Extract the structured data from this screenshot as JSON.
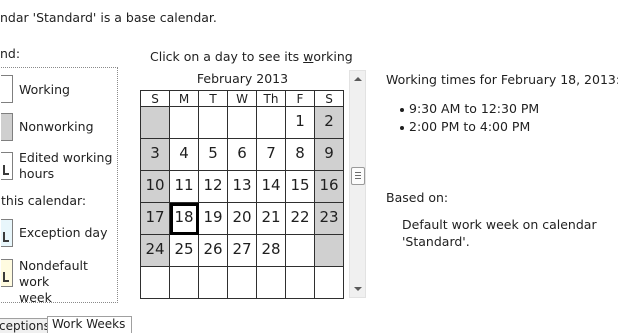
{
  "header": {
    "base_calendar_text": "ndar 'Standard' is a base calendar."
  },
  "legend": {
    "title": "nd:",
    "items": [
      {
        "label": "Working"
      },
      {
        "label": "Nonworking"
      },
      {
        "label_line1": "Edited working",
        "label_line2": "hours"
      }
    ],
    "section_title": "this calendar:",
    "calendar_items": [
      {
        "label": "Exception day"
      },
      {
        "label_line1": "Nondefault work",
        "label_line2": "week"
      }
    ]
  },
  "calendar": {
    "instruction_prefix": "Click on a day to see its ",
    "instruction_key": "w",
    "instruction_suffix": "orking",
    "month_title": "February 2013",
    "weekday_headers": [
      "S",
      "M",
      "T",
      "W",
      "Th",
      "F",
      "S"
    ],
    "weeks": [
      [
        "",
        "",
        "",
        "",
        "",
        "1",
        "2"
      ],
      [
        "3",
        "4",
        "5",
        "6",
        "7",
        "8",
        "9"
      ],
      [
        "10",
        "11",
        "12",
        "13",
        "14",
        "15",
        "16"
      ],
      [
        "17",
        "18",
        "19",
        "20",
        "21",
        "22",
        "23"
      ],
      [
        "24",
        "25",
        "26",
        "27",
        "28",
        "",
        ""
      ],
      [
        "",
        "",
        "",
        "",
        "",
        "",
        ""
      ]
    ],
    "selected_day": "18"
  },
  "working_times": {
    "title": "Working times for February 18, 2013:",
    "times": [
      "9:30 AM to 12:30 PM",
      "2:00 PM to 4:00 PM"
    ]
  },
  "based_on": {
    "title": "Based on:",
    "line1": "Default work week on calendar",
    "line2": "'Standard'."
  },
  "tabs": [
    {
      "label": "ceptions"
    },
    {
      "label": "Work Weeks"
    }
  ]
}
